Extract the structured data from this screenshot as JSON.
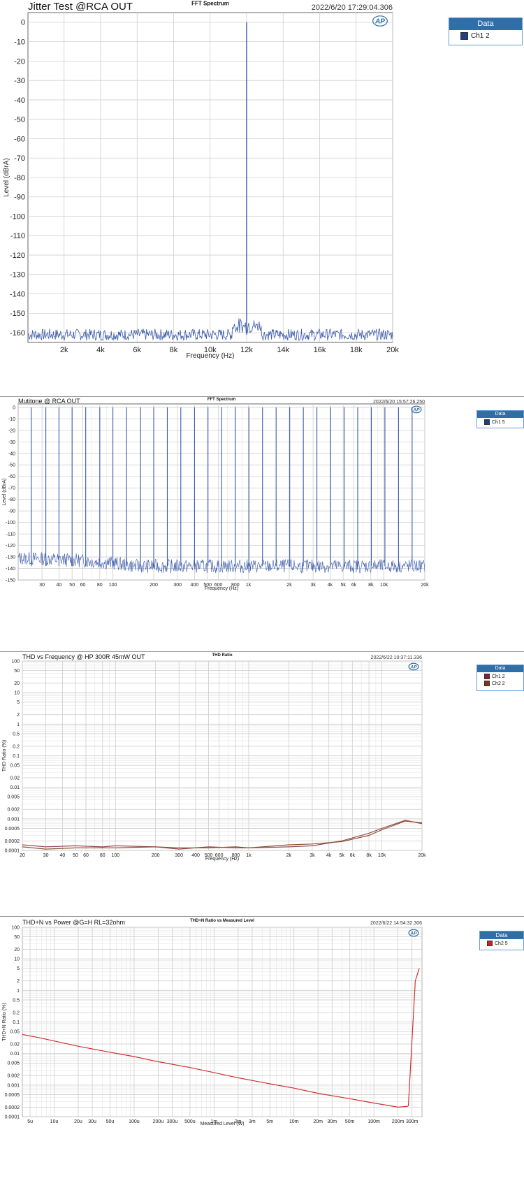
{
  "chart_data": [
    {
      "type": "line",
      "title_left": "Jitter Test @RCA OUT",
      "title_center": "FFT Spectrum",
      "timestamp": "2022/6/20 17:29:04.306",
      "xlabel": "Frequency (Hz)",
      "ylabel": "Level (dBrA)",
      "xscale": "linear",
      "xlim": [
        20,
        20000
      ],
      "ylim": [
        -165,
        5
      ],
      "yticks": [
        0,
        -10,
        -20,
        -30,
        -40,
        -50,
        -60,
        -70,
        -80,
        -90,
        -100,
        -110,
        -120,
        -130,
        -140,
        -150,
        -160
      ],
      "xticks": [
        2000,
        4000,
        6000,
        8000,
        10000,
        12000,
        14000,
        16000,
        18000,
        20000
      ],
      "xtick_labels": [
        "2k",
        "4k",
        "6k",
        "8k",
        "10k",
        "12k",
        "14k",
        "16k",
        "18k",
        "20k"
      ],
      "grid": true,
      "legend": {
        "title": "Data",
        "entries": [
          {
            "name": "Ch1 2",
            "color": "#1f3f88"
          }
        ]
      },
      "series": [
        {
          "name": "Ch1 2",
          "color": "#3a5aa8",
          "noise_floor": -161,
          "peaks": [
            {
              "x": 12000,
              "y": 0
            }
          ]
        }
      ]
    },
    {
      "type": "line",
      "title_left": "Mutitone @ RCA OUT",
      "title_center": "FFT Spectrum",
      "timestamp": "2022/6/20 15:57:26.250",
      "xlabel": "Frequency (Hz)",
      "ylabel": "Level (dBrA)",
      "xscale": "log",
      "xlim": [
        20,
        20000
      ],
      "ylim": [
        -150,
        3
      ],
      "yticks": [
        0,
        -10,
        -20,
        -30,
        -40,
        -50,
        -60,
        -70,
        -80,
        -90,
        -100,
        -110,
        -120,
        -130,
        -140,
        -150
      ],
      "xticks": [
        30,
        40,
        50,
        60,
        80,
        100,
        200,
        300,
        400,
        500,
        600,
        800,
        1000,
        2000,
        3000,
        4000,
        5000,
        6000,
        8000,
        10000,
        20000
      ],
      "xtick_labels": [
        "30",
        "40",
        "50",
        "60",
        "80",
        "100",
        "200",
        "300",
        "400",
        "500",
        "600",
        "800",
        "1k",
        "2k",
        "3k",
        "4k",
        "5k",
        "6k",
        "8k",
        "10k",
        "20k"
      ],
      "grid": true,
      "legend": {
        "title": "Data",
        "entries": [
          {
            "name": "Ch1 5",
            "color": "#1f3f88"
          }
        ]
      },
      "series": [
        {
          "name": "Ch1 5",
          "color": "#3a5aa8",
          "noise_floor": -138,
          "tone_frequencies": [
            25,
            32,
            40,
            50,
            63,
            80,
            100,
            126,
            160,
            200,
            252,
            317,
            400,
            503,
            634,
            800,
            1008,
            1270,
            1600,
            2016,
            2540,
            3200,
            4032,
            5080,
            6400,
            8063,
            10159,
            12800,
            16127
          ],
          "tone_level": 0
        }
      ]
    },
    {
      "type": "line",
      "title_left": "THD vs Frequency @ HP 300R 45mW OUT",
      "title_center": "THD Ratio",
      "timestamp": "2022/6/22 10:37:11.336",
      "xlabel": "Frequency (Hz)",
      "ylabel": "THD Ratio (%)",
      "xscale": "log",
      "yscale": "log",
      "xlim": [
        20,
        20000
      ],
      "ylim": [
        0.0001,
        100
      ],
      "yticks": [
        100,
        50,
        20,
        10,
        5,
        2,
        1,
        0.5,
        0.2,
        0.1,
        0.05,
        0.02,
        0.01,
        0.005,
        0.002,
        0.001,
        0.0005,
        0.0002,
        0.0001
      ],
      "ytick_labels": [
        "100",
        "50",
        "20",
        "10",
        "5",
        "2",
        "1",
        "0.5",
        "0.2",
        "0.1",
        "0.05",
        "0.02",
        "0.01",
        "0.005",
        "0.002",
        "0.001",
        "0.0005",
        "0.0002",
        "0.0001"
      ],
      "xticks": [
        20,
        30,
        40,
        50,
        60,
        80,
        100,
        200,
        300,
        400,
        500,
        600,
        800,
        1000,
        2000,
        3000,
        4000,
        5000,
        6000,
        8000,
        10000,
        20000
      ],
      "xtick_labels": [
        "20",
        "30",
        "40",
        "50",
        "60",
        "80",
        "100",
        "200",
        "300",
        "400",
        "500",
        "600",
        "800",
        "1k",
        "2k",
        "3k",
        "4k",
        "5k",
        "6k",
        "8k",
        "10k",
        "20k"
      ],
      "grid": true,
      "legend": {
        "title": "Data",
        "entries": [
          {
            "name": "Ch1 2",
            "color": "#8b1e3f"
          },
          {
            "name": "Ch2 2",
            "color": "#7a3b10"
          }
        ]
      },
      "series": [
        {
          "name": "Ch1 2",
          "color": "#9a4a5a",
          "x": [
            20,
            30,
            50,
            80,
            100,
            200,
            300,
            500,
            800,
            1000,
            2000,
            3000,
            5000,
            8000,
            10000,
            15000,
            20000
          ],
          "y": [
            0.00015,
            0.00013,
            0.00014,
            0.00013,
            0.00014,
            0.00013,
            0.00011,
            0.00013,
            0.00012,
            0.00012,
            0.00013,
            0.00014,
            0.0002,
            0.00035,
            0.0005,
            0.0009,
            0.0007
          ]
        },
        {
          "name": "Ch2 2",
          "color": "#8a5530",
          "x": [
            20,
            30,
            50,
            80,
            100,
            200,
            300,
            500,
            800,
            1000,
            2000,
            3000,
            5000,
            8000,
            10000,
            15000,
            20000
          ],
          "y": [
            0.00013,
            0.00011,
            0.00012,
            0.00012,
            0.00012,
            0.00013,
            0.00012,
            0.00012,
            0.00013,
            0.00012,
            0.00015,
            0.00016,
            0.00019,
            0.0003,
            0.00045,
            0.00085,
            0.00075
          ]
        }
      ]
    },
    {
      "type": "line",
      "title_left": "THD+N vs Power @G=H RL=32ohm",
      "title_center": "THD+N Ratio vs Measured Level",
      "timestamp": "2022/6/22 14:54:32.306",
      "xlabel": "Measured Level (W)",
      "ylabel": "THD+N Ratio (%)",
      "xscale": "log",
      "yscale": "log",
      "xlim": [
        4e-06,
        0.4
      ],
      "ylim": [
        0.0001,
        100
      ],
      "yticks": [
        100,
        50,
        20,
        10,
        5,
        2,
        1,
        0.5,
        0.2,
        0.1,
        0.05,
        0.02,
        0.01,
        0.005,
        0.002,
        0.001,
        0.0005,
        0.0002,
        0.0001
      ],
      "ytick_labels": [
        "100",
        "50",
        "20",
        "10",
        "5",
        "2",
        "1",
        "0.5",
        "0.2",
        "0.1",
        "0.05",
        "0.02",
        "0.01",
        "0.005",
        "0.002",
        "0.001",
        "0.0005",
        "0.0002",
        "0.0001"
      ],
      "xticks": [
        5e-06,
        1e-05,
        2e-05,
        3e-05,
        5e-05,
        0.0001,
        0.0002,
        0.0003,
        0.0005,
        0.001,
        0.002,
        0.003,
        0.005,
        0.01,
        0.02,
        0.03,
        0.05,
        0.1,
        0.2,
        0.3
      ],
      "xtick_labels": [
        "5u",
        "10u",
        "20u",
        "30u",
        "50u",
        "100u",
        "200u",
        "300u",
        "500u",
        "1m",
        "2m",
        "3m",
        "5m",
        "10m",
        "20m",
        "30m",
        "50m",
        "100m",
        "200m",
        "300m"
      ],
      "grid": true,
      "legend": {
        "title": "Data",
        "entries": [
          {
            "name": "Ch2 5",
            "color": "#cc2222"
          }
        ]
      },
      "series": [
        {
          "name": "Ch2 5",
          "color": "#d03030",
          "x": [
            4e-06,
            6e-06,
            1e-05,
            2e-05,
            5e-05,
            0.0001,
            0.0002,
            0.0005,
            0.001,
            0.002,
            0.005,
            0.01,
            0.02,
            0.05,
            0.1,
            0.2,
            0.26,
            0.27,
            0.33,
            0.37
          ],
          "y": [
            0.04,
            0.033,
            0.025,
            0.017,
            0.011,
            0.008,
            0.0055,
            0.0036,
            0.0025,
            0.0017,
            0.0011,
            0.0008,
            0.00055,
            0.00037,
            0.00027,
            0.0002,
            0.00021,
            0.00022,
            2,
            5
          ]
        }
      ]
    }
  ],
  "ap_logo_text": "AP"
}
